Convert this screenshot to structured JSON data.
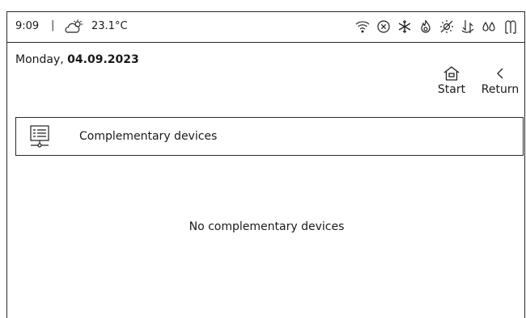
{
  "status_bar": {
    "time": "9:09",
    "separator": "|",
    "weather_icon": "partly-sunny-icon",
    "temperature": "23.1°C",
    "icons": [
      "wifi-icon",
      "alarm-x-icon",
      "snowflake-icon",
      "flame-icon",
      "sun-off-icon",
      "heat-pump-icon",
      "water-drops-icon",
      "hot-water-tap-icon"
    ]
  },
  "date": {
    "weekday": "Monday, ",
    "date": "04.09.2023"
  },
  "nav": {
    "start_label": "Start",
    "return_label": "Return"
  },
  "section": {
    "title": "Complementary devices",
    "icon": "device-list-icon"
  },
  "empty_message": "No complementary devices"
}
